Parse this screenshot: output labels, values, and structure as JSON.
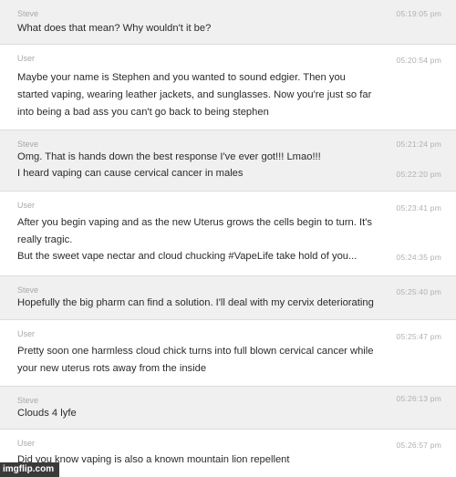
{
  "messages": [
    {
      "sender": "Steve",
      "lines": [
        {
          "text": "What does that mean? Why wouldn't it be?",
          "time": "05:19:05 pm"
        }
      ]
    },
    {
      "sender": "User",
      "lines": [
        {
          "text": "Maybe your name is Stephen and you wanted to sound edgier. Then you",
          "time": "05:20:54 pm"
        },
        {
          "text": "started vaping, wearing leather jackets, and sunglasses. Now you're just so far",
          "time": ""
        },
        {
          "text": "into being a bad ass you can't go back to being stephen",
          "time": ""
        }
      ]
    },
    {
      "sender": "Steve",
      "lines": [
        {
          "text": "Omg. That is hands down the best response I've ever got!!! Lmao!!!",
          "time": "05:21:24 pm"
        },
        {
          "text": "I heard vaping can cause cervical cancer in males",
          "time": "05:22:20 pm"
        }
      ]
    },
    {
      "sender": "User",
      "lines": [
        {
          "text": "After you begin vaping and as the new Uterus grows the cells begin to turn. It's",
          "time": "05:23:41 pm"
        },
        {
          "text": "really tragic.",
          "time": ""
        },
        {
          "text": "But the sweet vape nectar and cloud chucking #VapeLife take hold of you...",
          "time": "05:24:35 pm"
        }
      ]
    },
    {
      "sender": "Steve",
      "lines": [
        {
          "text": "Hopefully the big pharm can find a solution. I'll deal with my cervix deteriorating",
          "time": "05:25:40 pm"
        }
      ]
    },
    {
      "sender": "User",
      "lines": [
        {
          "text": "Pretty soon one harmless cloud chick turns into full blown cervical cancer while",
          "time": "05:25:47 pm"
        },
        {
          "text": "your new uterus rots away from the inside",
          "time": ""
        }
      ]
    },
    {
      "sender": "Steve",
      "lines": [
        {
          "text": "Clouds 4 lyfe",
          "time": "05:26:13 pm"
        }
      ]
    },
    {
      "sender": "User",
      "lines": [
        {
          "text": "Did you know vaping is also a known mountain lion repellent",
          "time": "05:26:57 pm"
        }
      ]
    }
  ],
  "watermark": "imgflip.com",
  "colors": {
    "steve_background": "#f0f0f0",
    "user_background": "#ffffff",
    "message_text": "#2b2b2b",
    "meta_text": "#a8a8a8"
  }
}
